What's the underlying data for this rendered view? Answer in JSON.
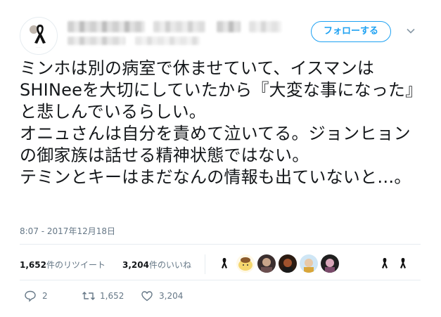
{
  "tweet": {
    "follow_label": "フォローする",
    "text": "ミンホは別の病室で休ませていて、イスマンはSHINeeを大切にしていたから『大変な事になった』と悲しんでいるらしい。\nオニュさんは自分を責めて泣いてる。ジョンヒョンの御家族は話せる精神状態ではない。\nテミンとキーはまだなんの情報も出ていないと…。",
    "timestamp": "8:07 - 2017年12月18日"
  },
  "stats": {
    "retweets_count": "1,652",
    "retweets_label": "件のリツイート",
    "likes_count": "3,204",
    "likes_label": "件のいいね"
  },
  "actions": {
    "reply_count": "2",
    "retweet_count": "1,652",
    "like_count": "3,204"
  },
  "icons": {
    "reply": "reply-icon",
    "retweet": "retweet-icon",
    "like": "heart-icon",
    "caret": "chevron-down-icon"
  },
  "colors": {
    "accent": "#1da1f2",
    "muted": "#657786",
    "text": "#14171a"
  }
}
